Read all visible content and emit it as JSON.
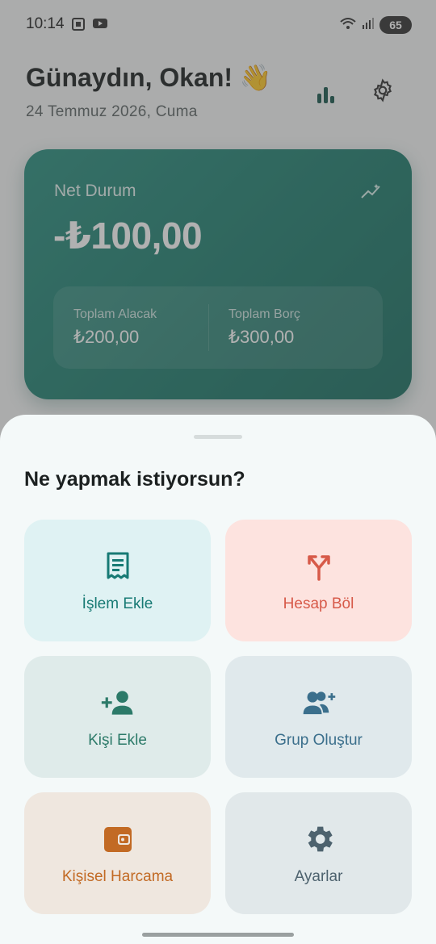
{
  "status": {
    "time": "10:14",
    "battery": "65"
  },
  "header": {
    "greeting": "Günaydın, Okan! 👋",
    "date": "24 Temmuz 2026, Cuma"
  },
  "balance_card": {
    "label": "Net Durum",
    "amount": "-₺100,00",
    "receivable_label": "Toplam Alacak",
    "receivable_value": "₺200,00",
    "debt_label": "Toplam Borç",
    "debt_value": "₺300,00"
  },
  "sheet": {
    "title": "Ne yapmak istiyorsun?",
    "actions": [
      {
        "label": "İşlem Ekle",
        "icon": "receipt-icon",
        "color": "#177a74"
      },
      {
        "label": "Hesap Böl",
        "icon": "split-icon",
        "color": "#d75a49"
      },
      {
        "label": "Kişi Ekle",
        "icon": "add-person-icon",
        "color": "#2c7a69"
      },
      {
        "label": "Grup Oluştur",
        "icon": "add-group-icon",
        "color": "#3b6f8c"
      },
      {
        "label": "Kişisel Harcama",
        "icon": "wallet-icon",
        "color": "#c26a24"
      },
      {
        "label": "Ayarlar",
        "icon": "gear-icon",
        "color": "#4d626e"
      }
    ]
  },
  "colors": {
    "card_primary": "#1f7d6e",
    "dim_overlay": "rgba(70,70,70,0.42)"
  }
}
